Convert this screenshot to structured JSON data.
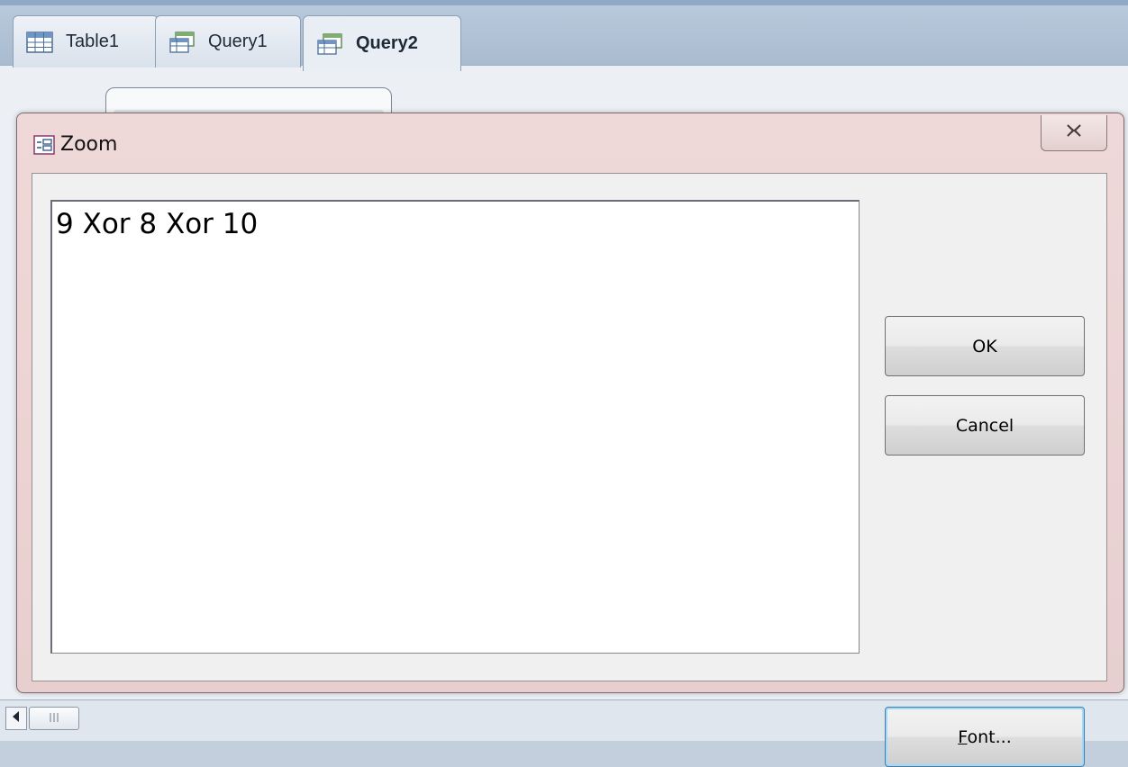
{
  "tabs": [
    {
      "label": "Table1",
      "icon": "table-icon",
      "active": false
    },
    {
      "label": "Query1",
      "icon": "query-icon",
      "active": false
    },
    {
      "label": "Query2",
      "icon": "query-icon",
      "active": true
    }
  ],
  "dialog": {
    "title": "Zoom",
    "icon": "zoom-form-icon",
    "close_icon": "close-icon",
    "text_value": "9 Xor 8 Xor 10",
    "ok_label": "OK",
    "cancel_label": "Cancel",
    "font_label_accel": "F",
    "font_label_rest": "ont..."
  },
  "colors": {
    "dialog_frame": "#ead3d2",
    "tab_strip": "#b9c9dc",
    "default_button_border": "#3c7fb1"
  }
}
